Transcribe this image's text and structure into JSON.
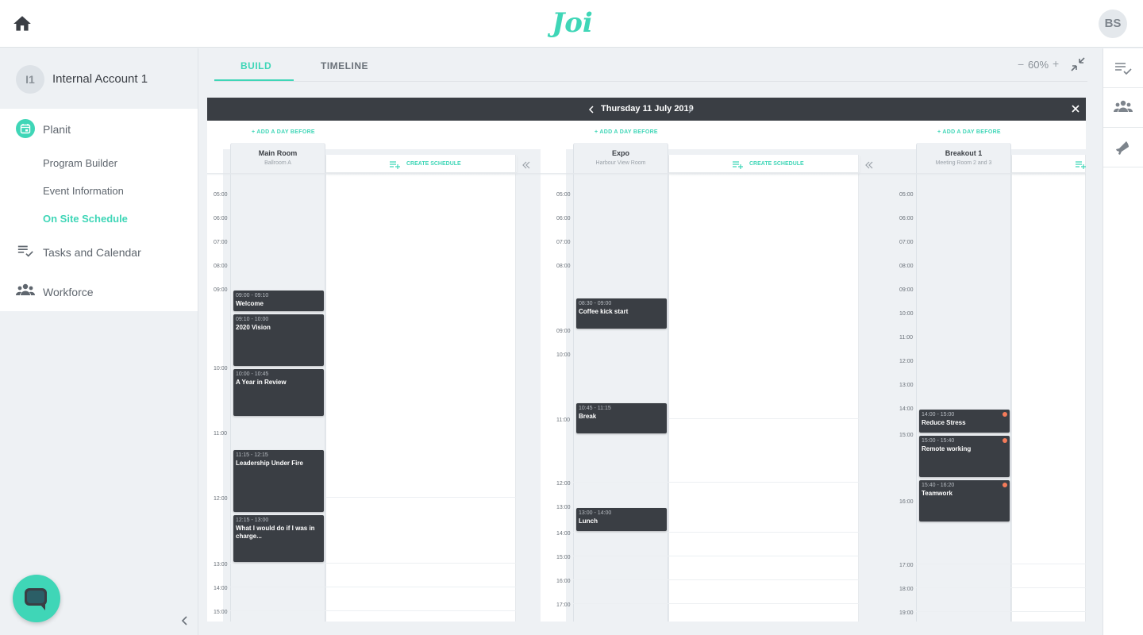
{
  "app": {
    "logo_text": "Joi",
    "user_initials": "BS",
    "brand_color": "#3fd6b7",
    "dark_color": "#3a3e44",
    "alert_color": "#f47b5a"
  },
  "account": {
    "initials": "I1",
    "name": "Internal Account 1"
  },
  "nav": {
    "planit": {
      "label": "Planit",
      "icon": "calendar-icon"
    },
    "sub": [
      "Program Builder",
      "Event Information",
      "On Site Schedule"
    ],
    "tasks": {
      "label": "Tasks and Calendar",
      "icon": "checklist-icon"
    },
    "workforce": {
      "label": "Workforce",
      "icon": "people-icon"
    }
  },
  "tabs": {
    "build": "BUILD",
    "timeline": "TIMELINE"
  },
  "zoom": {
    "minus": "−",
    "level": "60%",
    "plus": "+"
  },
  "schedule": {
    "day_title": "Thursday 11 July 2019",
    "add_day_label": "+ ADD A DAY BEFORE",
    "create_label": "CREATE SCHEDULE",
    "rooms": [
      {
        "name": "Main Room",
        "sub": "Ballroom A",
        "ticks": [
          "05:00",
          "06:00",
          "07:00",
          "08:00",
          "09:00",
          "10:00",
          "11:00",
          "12:00",
          "13:00",
          "14:00",
          "15:00"
        ],
        "events": [
          {
            "time": "09:00 - 09:10",
            "title": "Welcome",
            "alert": false
          },
          {
            "time": "09:10 - 10:00",
            "title": "2020 Vision",
            "alert": false
          },
          {
            "time": "10:00 - 10:45",
            "title": "A Year in Review",
            "alert": false
          },
          {
            "time": "11:15 - 12:15",
            "title": "Leadership Under Fire",
            "alert": false
          },
          {
            "time": "12:15 - 13:00",
            "title": "What I would do if I was in charge...",
            "alert": false
          }
        ]
      },
      {
        "name": "Expo",
        "sub": "Harbour View Room",
        "ticks": [
          "05:00",
          "06:00",
          "07:00",
          "08:00",
          "09:00",
          "10:00",
          "11:00",
          "12:00",
          "13:00",
          "14:00",
          "15:00",
          "16:00",
          "17:00"
        ],
        "events": [
          {
            "time": "08:30 - 09:00",
            "title": "Coffee kick start",
            "alert": false
          },
          {
            "time": "10:45 - 11:15",
            "title": "Break",
            "alert": false
          },
          {
            "time": "13:00 - 14:00",
            "title": "Lunch",
            "alert": false
          }
        ]
      },
      {
        "name": "Breakout 1",
        "sub": "Meeting Room 2 and 3",
        "ticks": [
          "05:00",
          "06:00",
          "07:00",
          "08:00",
          "09:00",
          "10:00",
          "11:00",
          "12:00",
          "13:00",
          "14:00",
          "15:00",
          "16:00",
          "17:00",
          "18:00",
          "19:00"
        ],
        "events": [
          {
            "time": "14:00 - 15:00",
            "title": "Reduce Stress",
            "alert": true
          },
          {
            "time": "15:00 - 15:40",
            "title": "Remote working",
            "alert": true
          },
          {
            "time": "15:40 - 16:20",
            "title": "Teamwork",
            "alert": true
          }
        ]
      }
    ]
  }
}
